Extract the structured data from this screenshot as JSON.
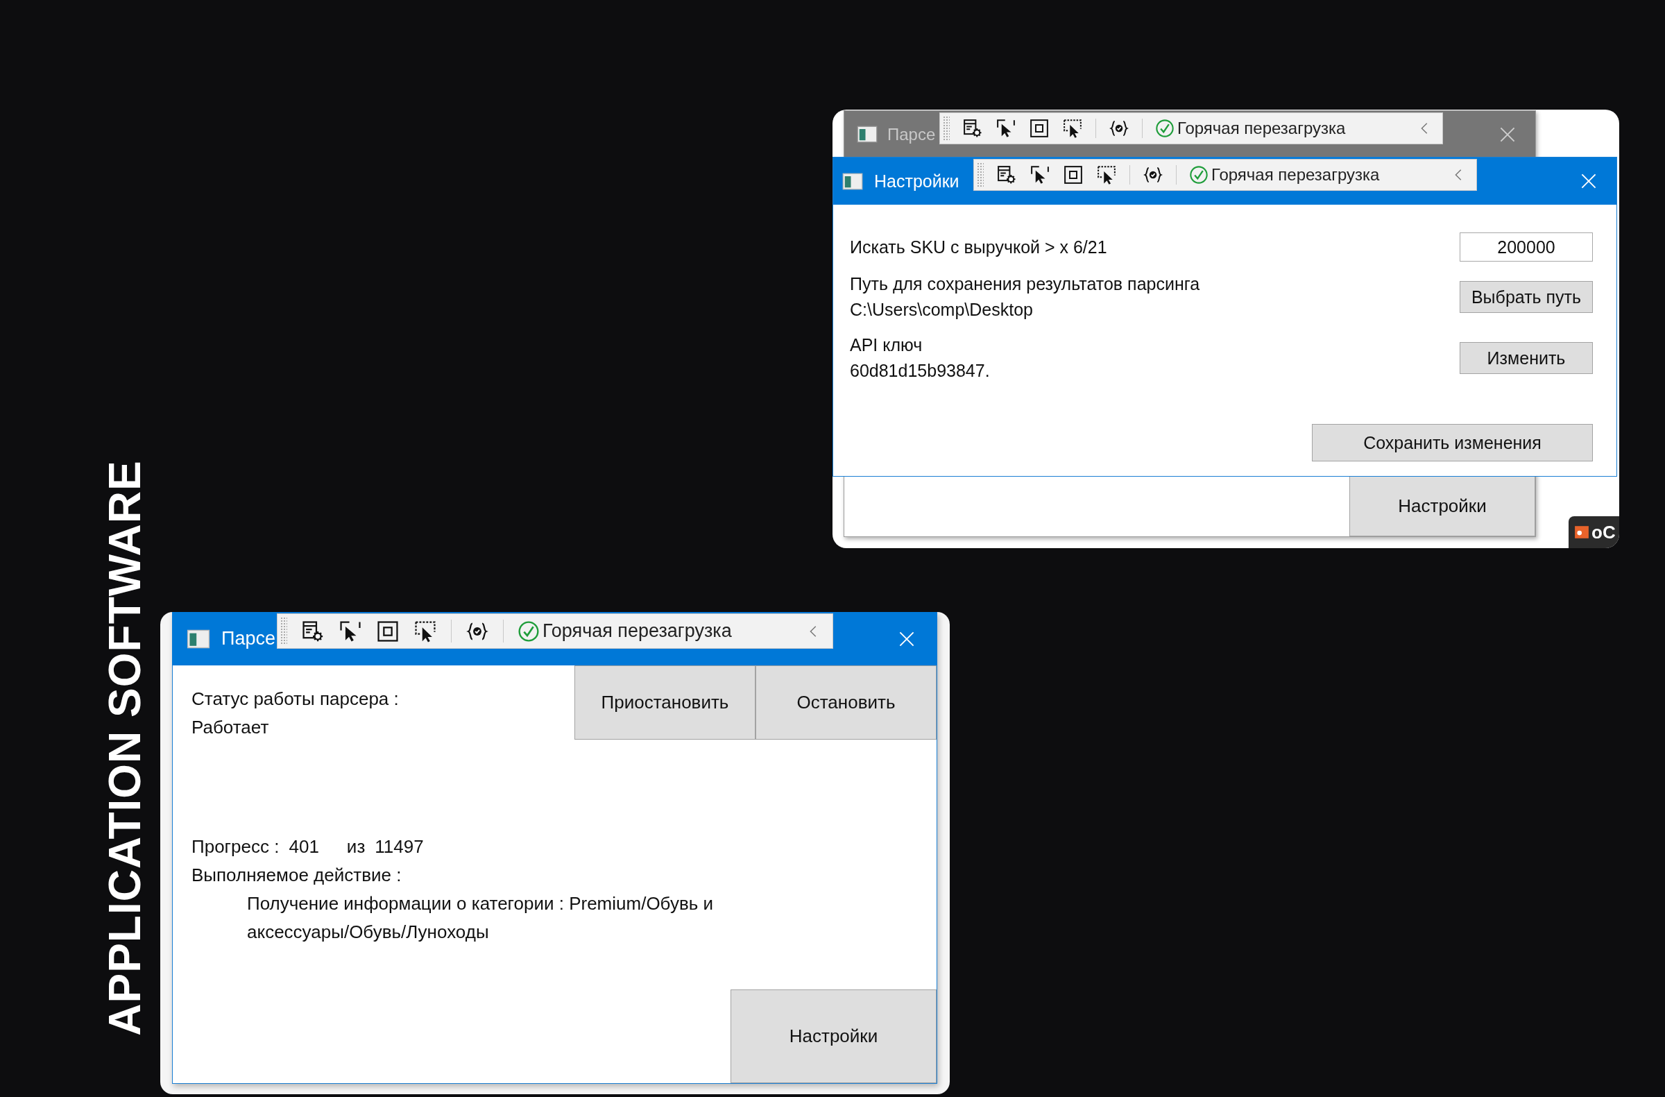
{
  "side_title": "APPLICATION SOFTWARE",
  "settings_shot": {
    "back_window": {
      "title": "Парсе",
      "toolbar": {
        "hot_reload_label": "Горячая перезагрузка"
      },
      "settings_button": "Настройки"
    },
    "settings_window": {
      "title": "Настройки",
      "toolbar": {
        "hot_reload_label": "Горячая перезагрузка"
      },
      "rows": [
        {
          "kind": "input",
          "label": "Искать SKU с выручкой > x 6/21",
          "value": "200000"
        },
        {
          "kind": "button",
          "label": "Путь для сохранения результатов парсинга",
          "detail": "C:\\Users\\comp\\Desktop",
          "button": "Выбрать путь"
        },
        {
          "kind": "button",
          "label": "API ключ",
          "detail": "60d81d15b93847.",
          "button": "Изменить"
        }
      ],
      "save_button": "Сохранить изменения"
    },
    "taskbar_item": "oC"
  },
  "parser_window": {
    "title": "Парсе",
    "toolbar": {
      "hot_reload_label": "Горячая перезагрузка"
    },
    "status_label": "Статус работы парсера :",
    "status": "Работает",
    "buttons": [
      "Приостановить",
      "Остановить"
    ],
    "progress": {
      "label": "Прогресс :",
      "current": "401",
      "of": "из",
      "total": "11497"
    },
    "action_label": "Выполняемое действие :",
    "action": "Получение информации о категории : Premium/Обувь и аксессуары/Обувь/Луноходы",
    "settings_button": "Настройки"
  }
}
